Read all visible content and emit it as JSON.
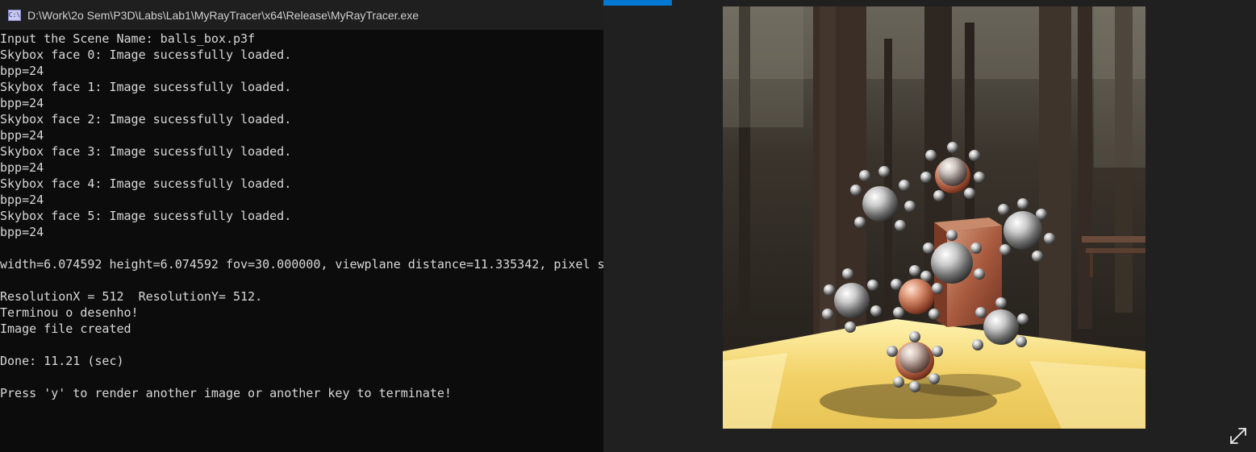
{
  "window": {
    "title": "D:\\Work\\2o Sem\\P3D\\Labs\\Lab1\\MyRayTracer\\x64\\Release\\MyRayTracer.exe",
    "icon": "console-app-icon",
    "icon_text": "C:\\"
  },
  "console": {
    "lines": [
      "Input the Scene Name: balls_box.p3f",
      "Skybox face 0: Image sucessfully loaded.",
      "bpp=24",
      "Skybox face 1: Image sucessfully loaded.",
      "bpp=24",
      "Skybox face 2: Image sucessfully loaded.",
      "bpp=24",
      "Skybox face 3: Image sucessfully loaded.",
      "bpp=24",
      "Skybox face 4: Image sucessfully loaded.",
      "bpp=24",
      "Skybox face 5: Image sucessfully loaded.",
      "bpp=24",
      "",
      "width=6.074592 height=6.074592 fov=30.000000, viewplane distance=11.335342, pixel s",
      "",
      "ResolutionX = 512  ResolutionY= 512.",
      "Terminou o desenho!",
      "Image file created",
      "",
      "Done: 11.21 (sec)",
      "",
      "Press 'y' to render another image or another key to terminate!"
    ]
  },
  "viewer": {
    "accent_color": "#0078d4",
    "image": "rendered-scene-reflective-spheres-box-forest-skybox",
    "expand_icon": "expand-icon"
  },
  "colors": {
    "console_bg": "#0c0c0c",
    "console_text": "#d8d8d8",
    "titlebar_bg": "#1f1f1f",
    "viewer_bg": "#202020",
    "floor": "#f3d470",
    "forest": "#2b2620"
  }
}
